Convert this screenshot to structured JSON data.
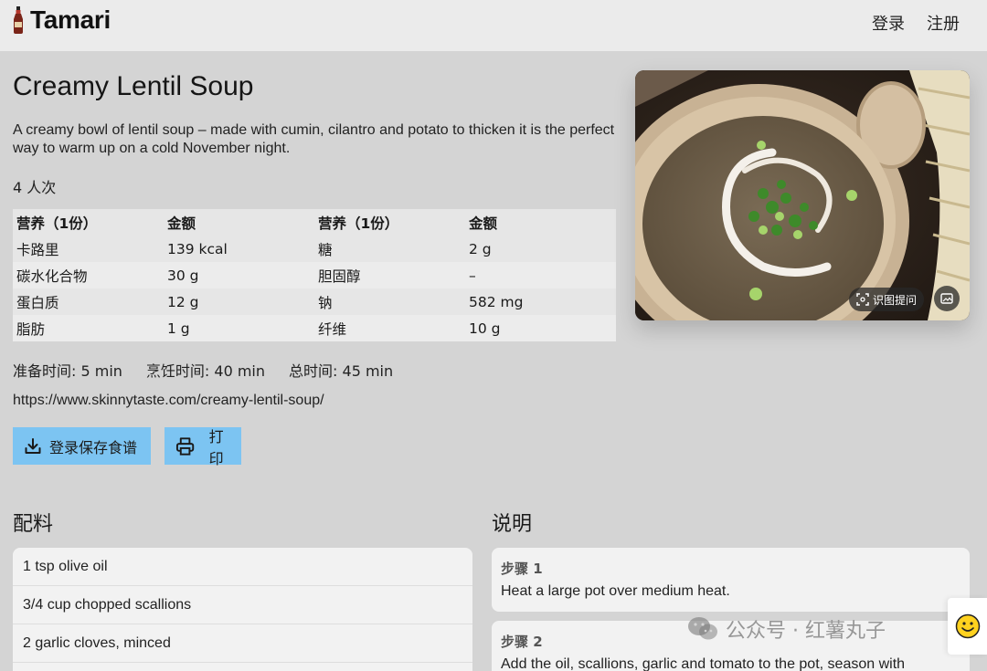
{
  "header": {
    "brand": "Tamari",
    "nav": {
      "login": "登录",
      "register": "注册"
    }
  },
  "recipe": {
    "title": "Creamy Lentil Soup",
    "description": "A creamy bowl of lentil soup – made with cumin, cilantro and potato to thicken it is the perfect way to warm up on a cold November night.",
    "servings": "4 人次",
    "nutrition": {
      "headers": [
        "营养（1份）",
        "金额",
        "营养（1份）",
        "金额"
      ],
      "rows": [
        [
          "卡路里",
          "139 kcal",
          "糖",
          "2 g"
        ],
        [
          "碳水化合物",
          "30 g",
          "胆固醇",
          "–"
        ],
        [
          "蛋白质",
          "12 g",
          "钠",
          "582 mg"
        ],
        [
          "脂肪",
          "1 g",
          "纤维",
          "10 g"
        ]
      ]
    },
    "times": {
      "prep": "准备时间: 5 min",
      "cook": "烹饪时间: 40 min",
      "total": "总时间: 45 min"
    },
    "source_url": "https://www.skinnytaste.com/creamy-lentil-soup/",
    "buttons": {
      "save": "登录保存食谱",
      "print": "打印"
    },
    "photo": {
      "ask_label": "识图提问"
    }
  },
  "ingredients": {
    "title": "配料",
    "items": [
      "1 tsp olive oil",
      "3/4 cup chopped scallions",
      "2 garlic cloves, minced"
    ]
  },
  "instructions": {
    "title": "说明",
    "steps": [
      {
        "label": "步骤 1",
        "text": "Heat a large pot over medium heat."
      },
      {
        "label": "步骤 2",
        "text": "Add the oil, scallions, garlic and tomato to the pot, season with"
      }
    ]
  },
  "watermark": {
    "text": "公众号 · 红薯丸子"
  },
  "colors": {
    "accent": "#7cc4f2",
    "background": "#d4d4d4",
    "topbar": "#ebebeb"
  }
}
